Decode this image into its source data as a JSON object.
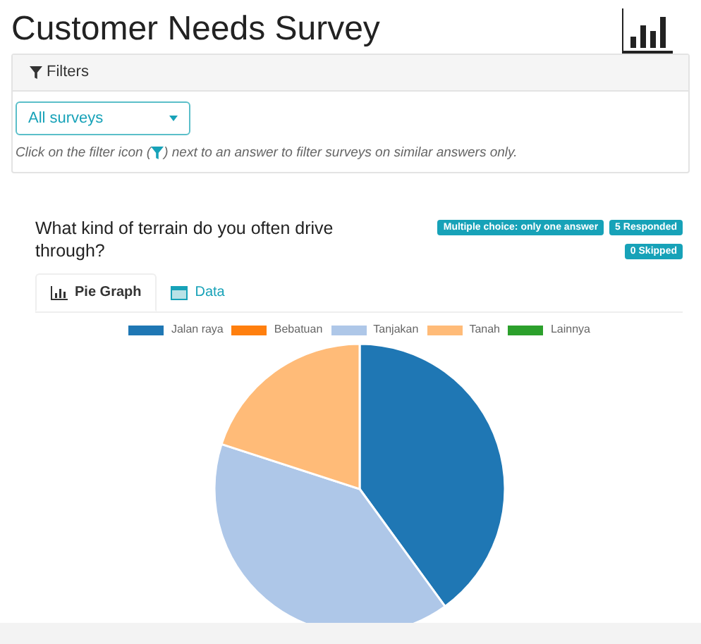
{
  "page": {
    "title": "Customer Needs Survey"
  },
  "filters": {
    "heading": "Filters",
    "select": {
      "value": "All surveys"
    },
    "hint_before": "Click on the filter icon (",
    "hint_after": ") next to an answer to filter surveys on similar answers only."
  },
  "question": {
    "text": "What kind of terrain do you often drive through?",
    "badges": [
      "Multiple choice: only one answer",
      "5 Responded",
      "0 Skipped"
    ],
    "tabs": [
      {
        "label": "Pie Graph",
        "kind": "chart",
        "selected": true
      },
      {
        "label": "Data",
        "kind": "table",
        "selected": false
      }
    ],
    "chart_data": {
      "type": "pie",
      "categories": [
        "Jalan raya",
        "Bebatuan",
        "Tanjakan",
        "Tanah",
        "Lainnya"
      ],
      "legend": "top",
      "series": [
        {
          "colors": [
            "#1f77b4",
            "#ff7f0e",
            "#aec7e8",
            "#ffbb78",
            "#2ca02c"
          ],
          "values": [
            40,
            0,
            40,
            20,
            0
          ]
        }
      ]
    }
  }
}
